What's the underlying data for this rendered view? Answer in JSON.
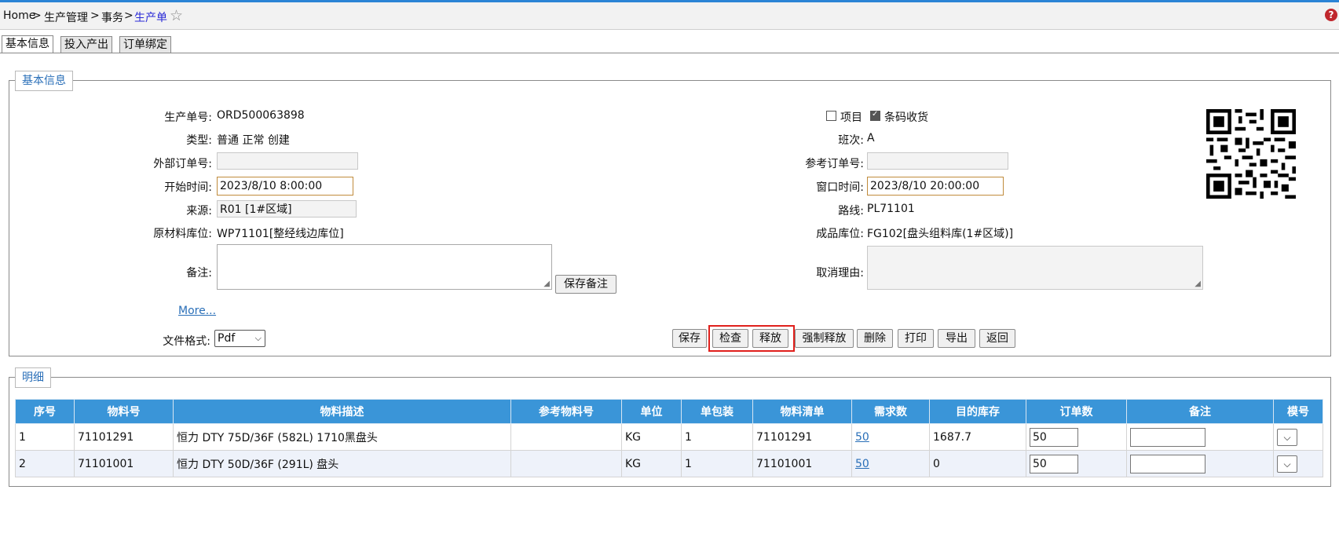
{
  "breadcrumb": {
    "home": "Home",
    "sep": ">",
    "level1": "生产管理",
    "level2": "事务",
    "current": "生产单"
  },
  "help_label": "?",
  "tabs": [
    "基本信息",
    "投入产出",
    "订单绑定"
  ],
  "basic": {
    "legend": "基本信息",
    "order_no_label": "生产单号:",
    "order_no": "ORD500063898",
    "type_label": "类型:",
    "type_value": "普通 正常 创建",
    "ext_order_label": "外部订单号:",
    "ext_order_value": "",
    "start_time_label": "开始时间:",
    "start_time": "2023/8/10 8:00:00",
    "source_label": "来源:",
    "source_value": "R01 [1#区域]",
    "raw_loc_label": "原材料库位:",
    "raw_loc_value": "WP71101[整经线边库位]",
    "remark_label": "备注:",
    "save_remark": "保存备注",
    "more_link": "More...",
    "file_format_label": "文件格式:",
    "file_format_value": "Pdf",
    "project_label": "项目",
    "project_checked": false,
    "barcode_label": "条码收货",
    "barcode_checked": true,
    "shift_label": "班次:",
    "shift_value": "A",
    "ref_order_label": "参考订单号:",
    "ref_order_value": "",
    "window_time_label": "窗口时间:",
    "window_time": "2023/8/10 20:00:00",
    "route_label": "路线:",
    "route_value": "PL71101",
    "fg_loc_label": "成品库位:",
    "fg_loc_value": "FG102[盘头组料库(1#区域)]",
    "cancel_reason_label": "取消理由:"
  },
  "actions": {
    "save": "保存",
    "check": "检查",
    "release": "释放",
    "force_release": "强制释放",
    "delete": "删除",
    "print": "打印",
    "export": "导出",
    "back": "返回"
  },
  "details": {
    "legend": "明细",
    "columns": [
      "序号",
      "物料号",
      "物料描述",
      "参考物料号",
      "单位",
      "单包装",
      "物料清单",
      "需求数",
      "目的库存",
      "订单数",
      "备注",
      "模号"
    ],
    "rows": [
      {
        "seq": "1",
        "item": "71101291",
        "desc": "恒力 DTY 75D/36F (582L) 1710黑盘头",
        "ref": "",
        "uom": "KG",
        "pack": "1",
        "bom": "71101291",
        "req": "50",
        "stock": "1687.7",
        "qty": "50",
        "remark": ""
      },
      {
        "seq": "2",
        "item": "71101001",
        "desc": "恒力 DTY 50D/36F (291L) 盘头",
        "ref": "",
        "uom": "KG",
        "pack": "1",
        "bom": "71101001",
        "req": "50",
        "stock": "0",
        "qty": "50",
        "remark": ""
      }
    ]
  },
  "icons": {
    "star": "star-icon",
    "help": "help-icon",
    "caret": "chevron-down-icon"
  }
}
